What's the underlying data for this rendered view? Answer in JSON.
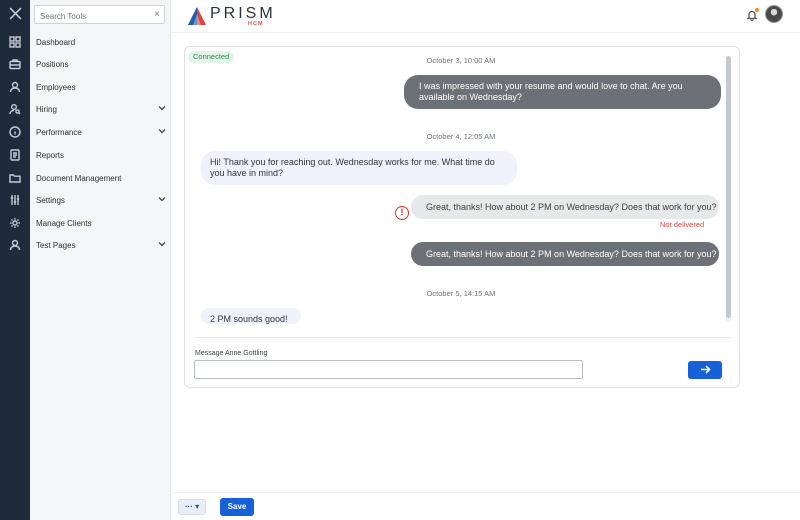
{
  "sidebar": {
    "search_placeholder": "Search Tools",
    "items": [
      {
        "label": "Dashboard",
        "chevron": false
      },
      {
        "label": "Positions",
        "chevron": false
      },
      {
        "label": "Employees",
        "chevron": false
      },
      {
        "label": "Hiring",
        "chevron": true
      },
      {
        "label": "Performance",
        "chevron": true
      },
      {
        "label": "Reports",
        "chevron": false
      },
      {
        "label": "Document Management",
        "chevron": false
      },
      {
        "label": "Settings",
        "chevron": true
      },
      {
        "label": "Manage Clients",
        "chevron": false
      },
      {
        "label": "Test Pages",
        "chevron": true
      }
    ]
  },
  "header": {
    "logo_text": "PRISM",
    "logo_sub": "HCM",
    "notification_dot": true
  },
  "chat": {
    "status": "Connected",
    "messages": [
      {
        "type": "timestamp",
        "text": "October 3, 10:00 AM"
      },
      {
        "type": "outgoing",
        "lines": [
          "I was impressed with your resume and would love to chat. Are you",
          "available on Wednesday?"
        ]
      },
      {
        "type": "timestamp",
        "text": "October 4, 12:05 AM"
      },
      {
        "type": "incoming",
        "lines": [
          "Hi! Thank you for reaching out. Wednesday works for me. What time do",
          "you have in mind?"
        ]
      },
      {
        "type": "outgoing-failed",
        "lines": [
          "Great, thanks! How about 2 PM on Wednesday? Does that work for you?"
        ],
        "status": "Not delivered"
      },
      {
        "type": "outgoing",
        "lines": [
          "Great, thanks! How about 2 PM on Wednesday? Does that work for you?"
        ]
      },
      {
        "type": "timestamp",
        "text": "October 5, 14:15 AM"
      },
      {
        "type": "incoming",
        "lines": [
          "2 PM sounds good!"
        ]
      }
    ],
    "input_label": "Message Anne Gottling",
    "input_value": ""
  },
  "footer": {
    "more_label": "··· ▾",
    "save_label": "Save"
  },
  "colors": {
    "rail": "#1f2a3a",
    "primary": "#1660d8",
    "error": "#e0463f",
    "outgoing_bubble": "#6b7177",
    "incoming_bubble": "#eef3fb"
  },
  "icons": [
    "close-icon",
    "dashboard-icon",
    "briefcase-icon",
    "user-icon",
    "user-search-icon",
    "info-icon",
    "report-icon",
    "folder-icon",
    "settings-sliders-icon",
    "gear-icon",
    "person-icon"
  ]
}
